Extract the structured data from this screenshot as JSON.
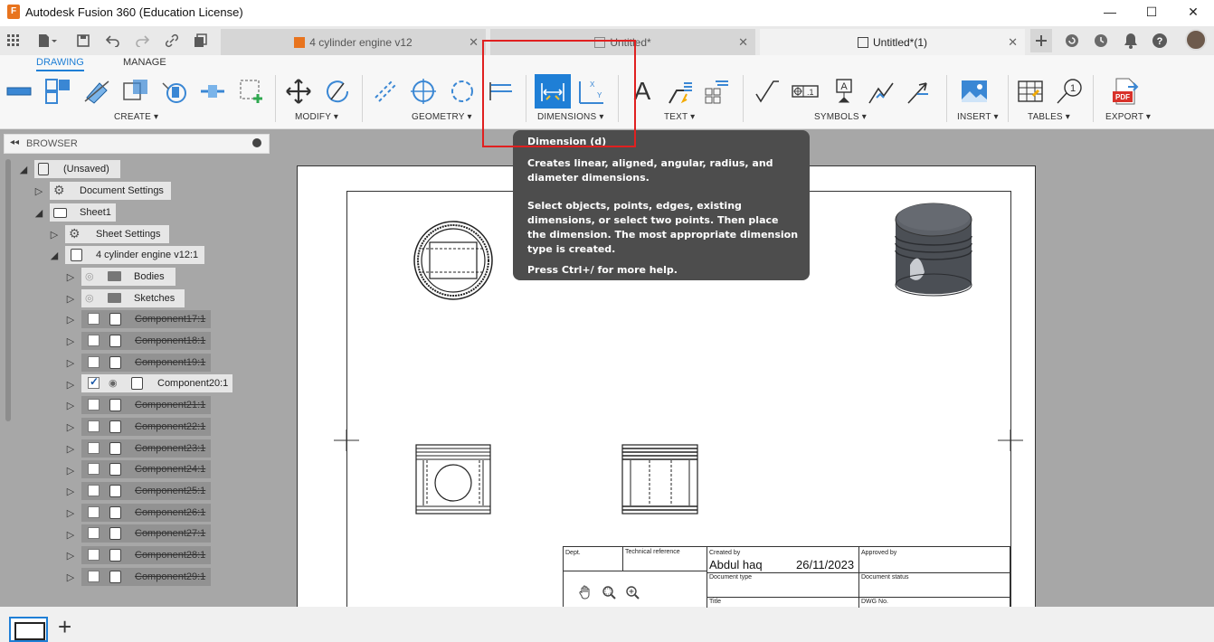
{
  "window": {
    "title": "Autodesk Fusion 360 (Education License)",
    "minimize": "—",
    "maximize": "☐",
    "close": "✕"
  },
  "tabs": [
    {
      "label": "4 cylinder engine v12",
      "close": "✕"
    },
    {
      "label": "Untitled*",
      "close": "✕"
    },
    {
      "label": "Untitled*(1)",
      "close": "✕"
    }
  ],
  "ribbon": {
    "tabs": [
      "DRAWING",
      "MANAGE"
    ],
    "groups": {
      "create": "CREATE ▾",
      "modify": "MODIFY ▾",
      "geometry": "GEOMETRY ▾",
      "dimensions": "DIMENSIONS ▾",
      "text": "TEXT ▾",
      "symbols": "SYMBOLS ▾",
      "insert": "INSERT ▾",
      "tables": "TABLES ▾",
      "export": "EXPORT ▾"
    },
    "accent": "#1f7fd6",
    "highlight_color": "#e02020"
  },
  "browser": {
    "header": "BROWSER",
    "back": "◂◂",
    "items": [
      {
        "label": "(Unsaved)"
      },
      {
        "label": "Document Settings"
      },
      {
        "label": "Sheet1"
      },
      {
        "label": "Sheet Settings"
      },
      {
        "label": "4 cylinder engine v12:1"
      },
      {
        "label": "Bodies"
      },
      {
        "label": "Sketches"
      },
      {
        "label": "Component17:1"
      },
      {
        "label": "Component18:1"
      },
      {
        "label": "Component19:1"
      },
      {
        "label": "Component20:1"
      },
      {
        "label": "Component21:1"
      },
      {
        "label": "Component22:1"
      },
      {
        "label": "Component23:1"
      },
      {
        "label": "Component24:1"
      },
      {
        "label": "Component25:1"
      },
      {
        "label": "Component26:1"
      },
      {
        "label": "Component27:1"
      },
      {
        "label": "Component28:1"
      },
      {
        "label": "Component29:1"
      }
    ]
  },
  "tooltip": {
    "title": "Dimension (d)",
    "p1": "Creates linear, aligned, angular, radius, and diameter dimensions.",
    "p2": "Select objects, points, edges, existing dimensions, or select two points. Then place the dimension. The most appropriate dimension type is created.",
    "p3": "Press Ctrl+/ for more help."
  },
  "title_block": {
    "dept": "Dept.",
    "technical_reference": "Technical reference",
    "created_by_label": "Created by",
    "created_by": "Abdul haq",
    "date": "26/11/2023",
    "approved_by": "Approved by",
    "document_type": "Document type",
    "document_status": "Document status",
    "title": "Title",
    "dwg_no": "DWG No."
  },
  "text_tool_glyph": "A",
  "add_sheet": "+"
}
